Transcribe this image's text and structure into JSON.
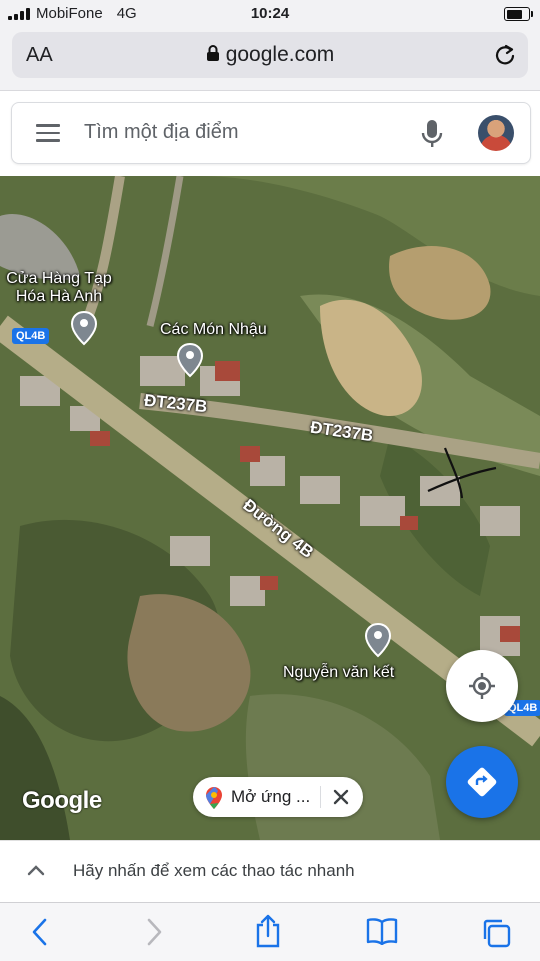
{
  "status_bar": {
    "carrier": "MobiFone",
    "network": "4G",
    "time": "10:24"
  },
  "browser": {
    "text_size_label": "AA",
    "domain": "google.com"
  },
  "search": {
    "placeholder": "Tìm một địa điểm"
  },
  "map": {
    "places": [
      {
        "name": "Cửa Hàng Tạp Hóa Hà Anh"
      },
      {
        "name": "Các Món Nhậu"
      },
      {
        "name": "Nguyễn văn kết"
      }
    ],
    "roads": {
      "dt237b_left": "ĐT237B",
      "dt237b_right": "ĐT237B",
      "duong4b": "Đường 4B"
    },
    "highway_shields": [
      "QL4B",
      "QL4B"
    ],
    "attribution": "Google",
    "open_app_label": "Mở ứng ..."
  },
  "quick_actions": {
    "label": "Hãy nhấn để xem các thao tác nhanh"
  },
  "colors": {
    "accent": "#1a73e8",
    "map_base": "#5c6e3f",
    "road": "#b5ad88"
  },
  "icons": [
    "menu-icon",
    "microphone-icon",
    "avatar",
    "place-pin-icon",
    "my-location-icon",
    "directions-icon",
    "maps-logo-icon",
    "close-icon",
    "chevron-up-icon",
    "back-icon",
    "forward-icon",
    "share-icon",
    "bookmarks-icon",
    "tabs-icon",
    "lock-icon",
    "reload-icon"
  ]
}
